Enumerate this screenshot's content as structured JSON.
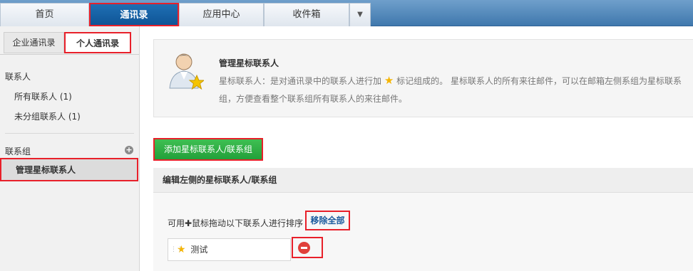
{
  "top_tabs": [
    "首页",
    "通讯录",
    "应用中心",
    "收件箱"
  ],
  "sidebar": {
    "tabs": [
      "企业通讯录",
      "个人通讯录"
    ],
    "contacts_heading": "联系人",
    "contacts_items": [
      "所有联系人 (1)",
      "未分组联系人 (1)"
    ],
    "groups_heading": "联系组",
    "selected_item": "管理星标联系人"
  },
  "info": {
    "title": "管理星标联系人",
    "desc_part1": "星标联系人：是对通讯录中的联系人进行加",
    "desc_part2": "标记组成的。 星标联系人的所有来往邮件，可以在邮箱左侧系组为星标联系组，方便查看整个联系组所有联系人的来往邮件。"
  },
  "add_button": "添加星标联系人/联系组",
  "edit": {
    "header": "编辑左侧的星标联系人/联系组",
    "sort_hint": "可用✚鼠标拖动以下联系人进行排序",
    "remove_all": "移除全部",
    "contacts": [
      "测试"
    ]
  },
  "colors": {
    "accent_blue": "#0f5597",
    "add_green": "#22a03a",
    "highlight_red": "#e8202a",
    "star_yellow": "#f5b400"
  }
}
